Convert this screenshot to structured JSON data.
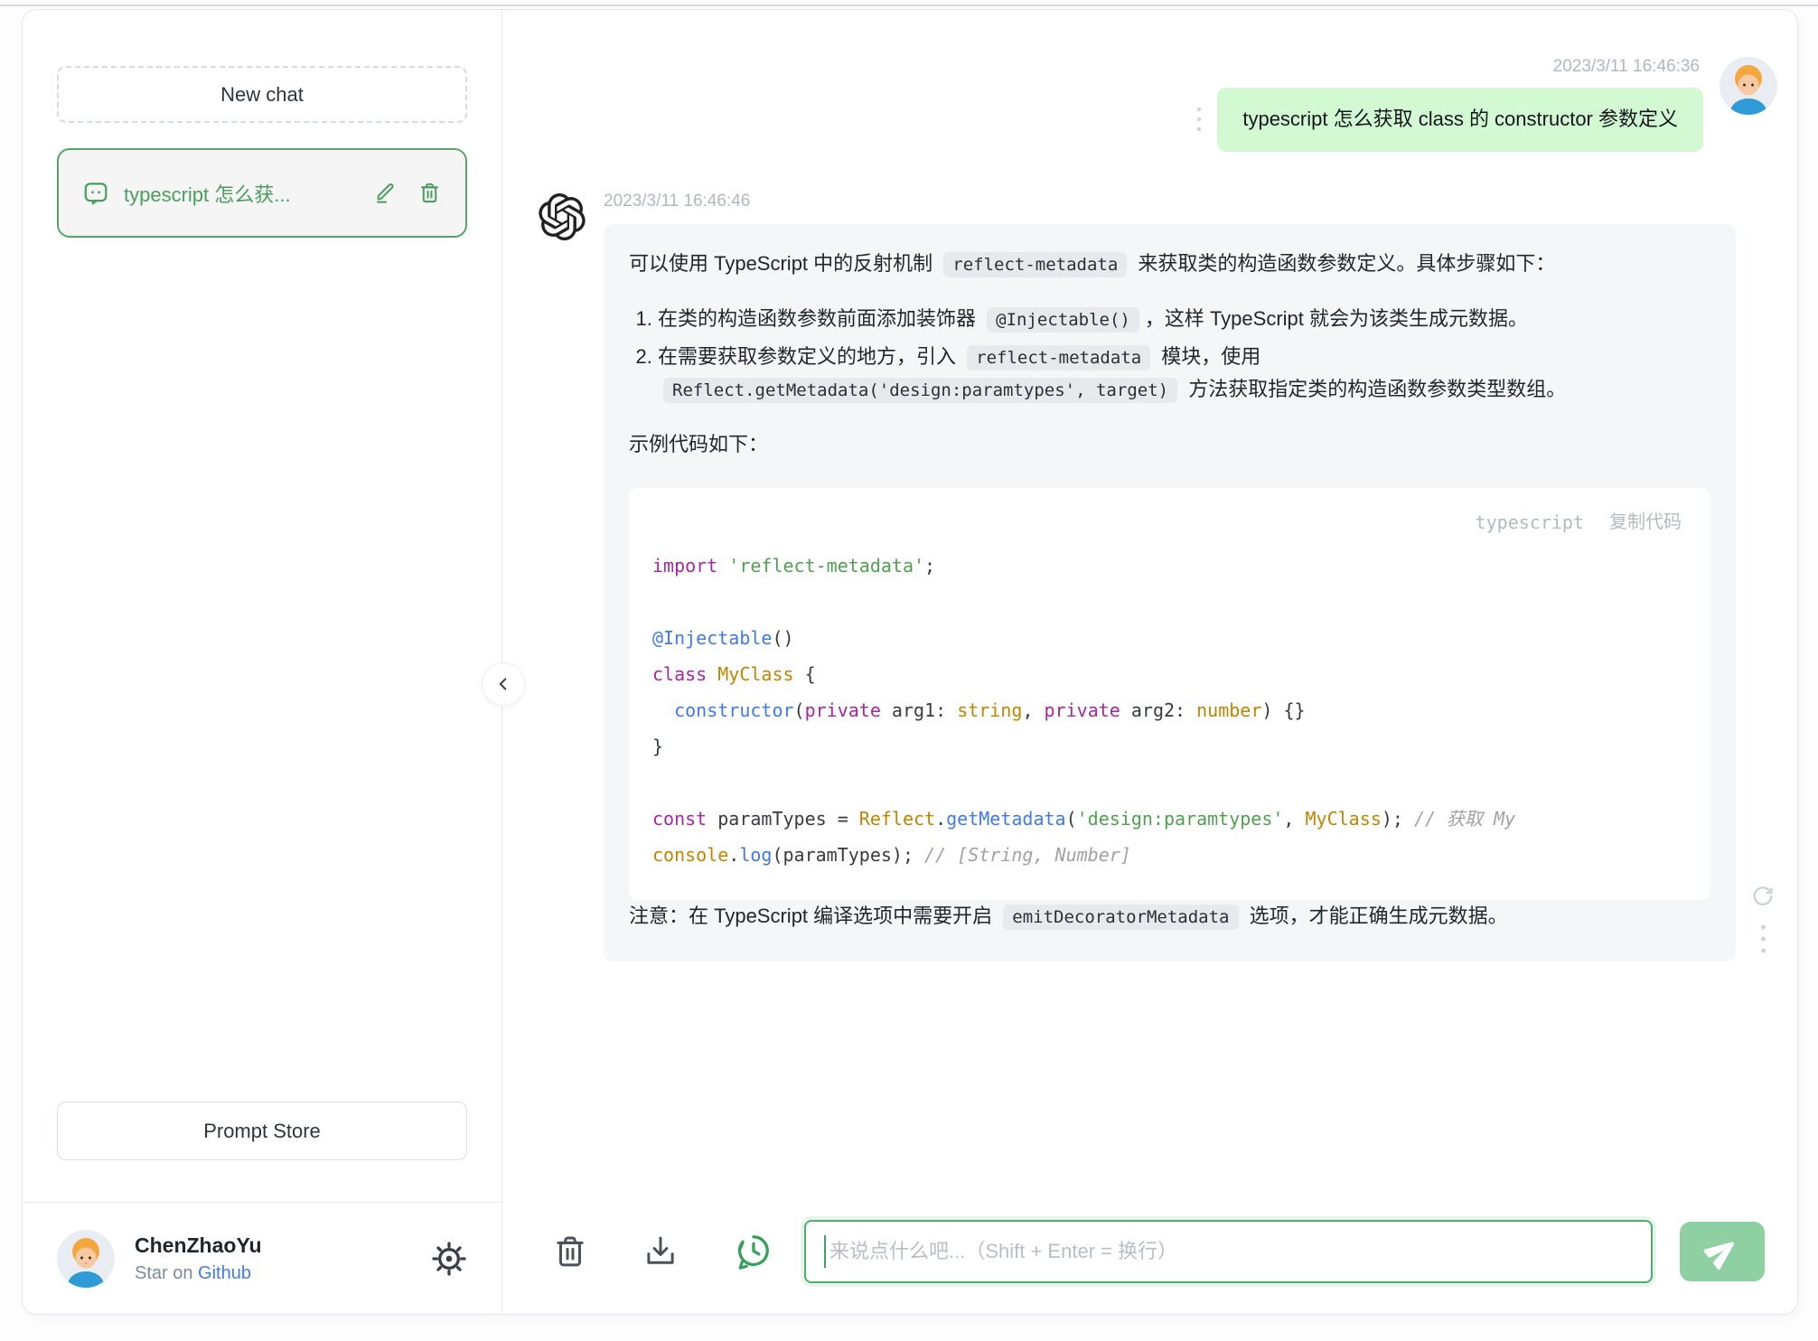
{
  "colors": {
    "accent_green": "#4a9e5f",
    "chat_item_border": "#57a469",
    "input_border": "#4dae6d",
    "user_bubble": "#d2f9d1",
    "assistant_bubble": "#f4f6f8",
    "send_button": "#8ed0a2",
    "link_blue": "#4479f2"
  },
  "sidebar": {
    "new_chat_label": "New chat",
    "chat_item": {
      "title": "typescript 怎么获..."
    },
    "prompt_store_label": "Prompt Store",
    "footer": {
      "name": "ChenZhaoYu",
      "star_prefix": "Star on ",
      "github_label": "Github"
    }
  },
  "chat": {
    "user": {
      "timestamp": "2023/3/11 16:46:36",
      "text": "typescript 怎么获取 class 的 constructor 参数定义"
    },
    "assistant": {
      "timestamp": "2023/3/11 16:46:46",
      "intro": [
        {
          "t": "可以使用 TypeScript 中的反射机制 "
        },
        {
          "t": "reflect-metadata",
          "code": true
        },
        {
          "t": " 来获取类的构造函数参数定义。具体步骤如下："
        }
      ],
      "steps": [
        {
          "segments": [
            {
              "t": "在类的构造函数参数前面添加装饰器 "
            },
            {
              "t": "@Injectable()",
              "code": true
            },
            {
              "t": "，这样 TypeScript 就会为该类生成元数据。"
            }
          ]
        },
        {
          "segments": [
            {
              "t": "在需要获取参数定义的地方，引入 "
            },
            {
              "t": "reflect-metadata",
              "code": true
            },
            {
              "t": " 模块，使用 "
            },
            {
              "t": "Reflect.getMetadata('design:paramtypes', target)",
              "code": true
            },
            {
              "t": " 方法获取指定类的构造函数参数类型数组。"
            }
          ]
        }
      ],
      "example_intro": "示例代码如下：",
      "code_block": {
        "language": "typescript",
        "copy_label": "复制代码",
        "lines": [
          [
            [
              "kw",
              "import"
            ],
            [
              "pln",
              " "
            ],
            [
              "str",
              "'reflect-metadata'"
            ],
            [
              "pln",
              ";"
            ]
          ],
          [],
          [
            [
              "fn",
              "@Injectable"
            ],
            [
              "pln",
              "()"
            ]
          ],
          [
            [
              "kw",
              "class"
            ],
            [
              "pln",
              " "
            ],
            [
              "type",
              "MyClass"
            ],
            [
              "pln",
              " {"
            ]
          ],
          [
            [
              "pln",
              "  "
            ],
            [
              "fn",
              "constructor"
            ],
            [
              "pln",
              "("
            ],
            [
              "kw",
              "private"
            ],
            [
              "pln",
              " arg1: "
            ],
            [
              "type",
              "string"
            ],
            [
              "pln",
              ", "
            ],
            [
              "kw",
              "private"
            ],
            [
              "pln",
              " arg2: "
            ],
            [
              "type",
              "number"
            ],
            [
              "pln",
              ") {}"
            ]
          ],
          [
            [
              "pln",
              "}"
            ]
          ],
          [],
          [
            [
              "kw",
              "const"
            ],
            [
              "pln",
              " paramTypes = "
            ],
            [
              "type",
              "Reflect"
            ],
            [
              "pln",
              "."
            ],
            [
              "fn",
              "getMetadata"
            ],
            [
              "pln",
              "("
            ],
            [
              "str",
              "'design:paramtypes'"
            ],
            [
              "pln",
              ", "
            ],
            [
              "type",
              "MyClass"
            ],
            [
              "pln",
              "); "
            ],
            [
              "cmt",
              "// 获取 My"
            ]
          ],
          [
            [
              "type",
              "console"
            ],
            [
              "pln",
              "."
            ],
            [
              "fn",
              "log"
            ],
            [
              "pln",
              "(paramTypes); "
            ],
            [
              "cmt",
              "// [String, Number]"
            ]
          ]
        ]
      },
      "note": [
        {
          "t": "注意：在 TypeScript 编译选项中需要开启 "
        },
        {
          "t": "emitDecoratorMetadata",
          "code": true
        },
        {
          "t": " 选项，才能正确生成元数据。"
        }
      ]
    }
  },
  "composer": {
    "placeholder": "来说点什么吧...（Shift + Enter = 换行）"
  }
}
